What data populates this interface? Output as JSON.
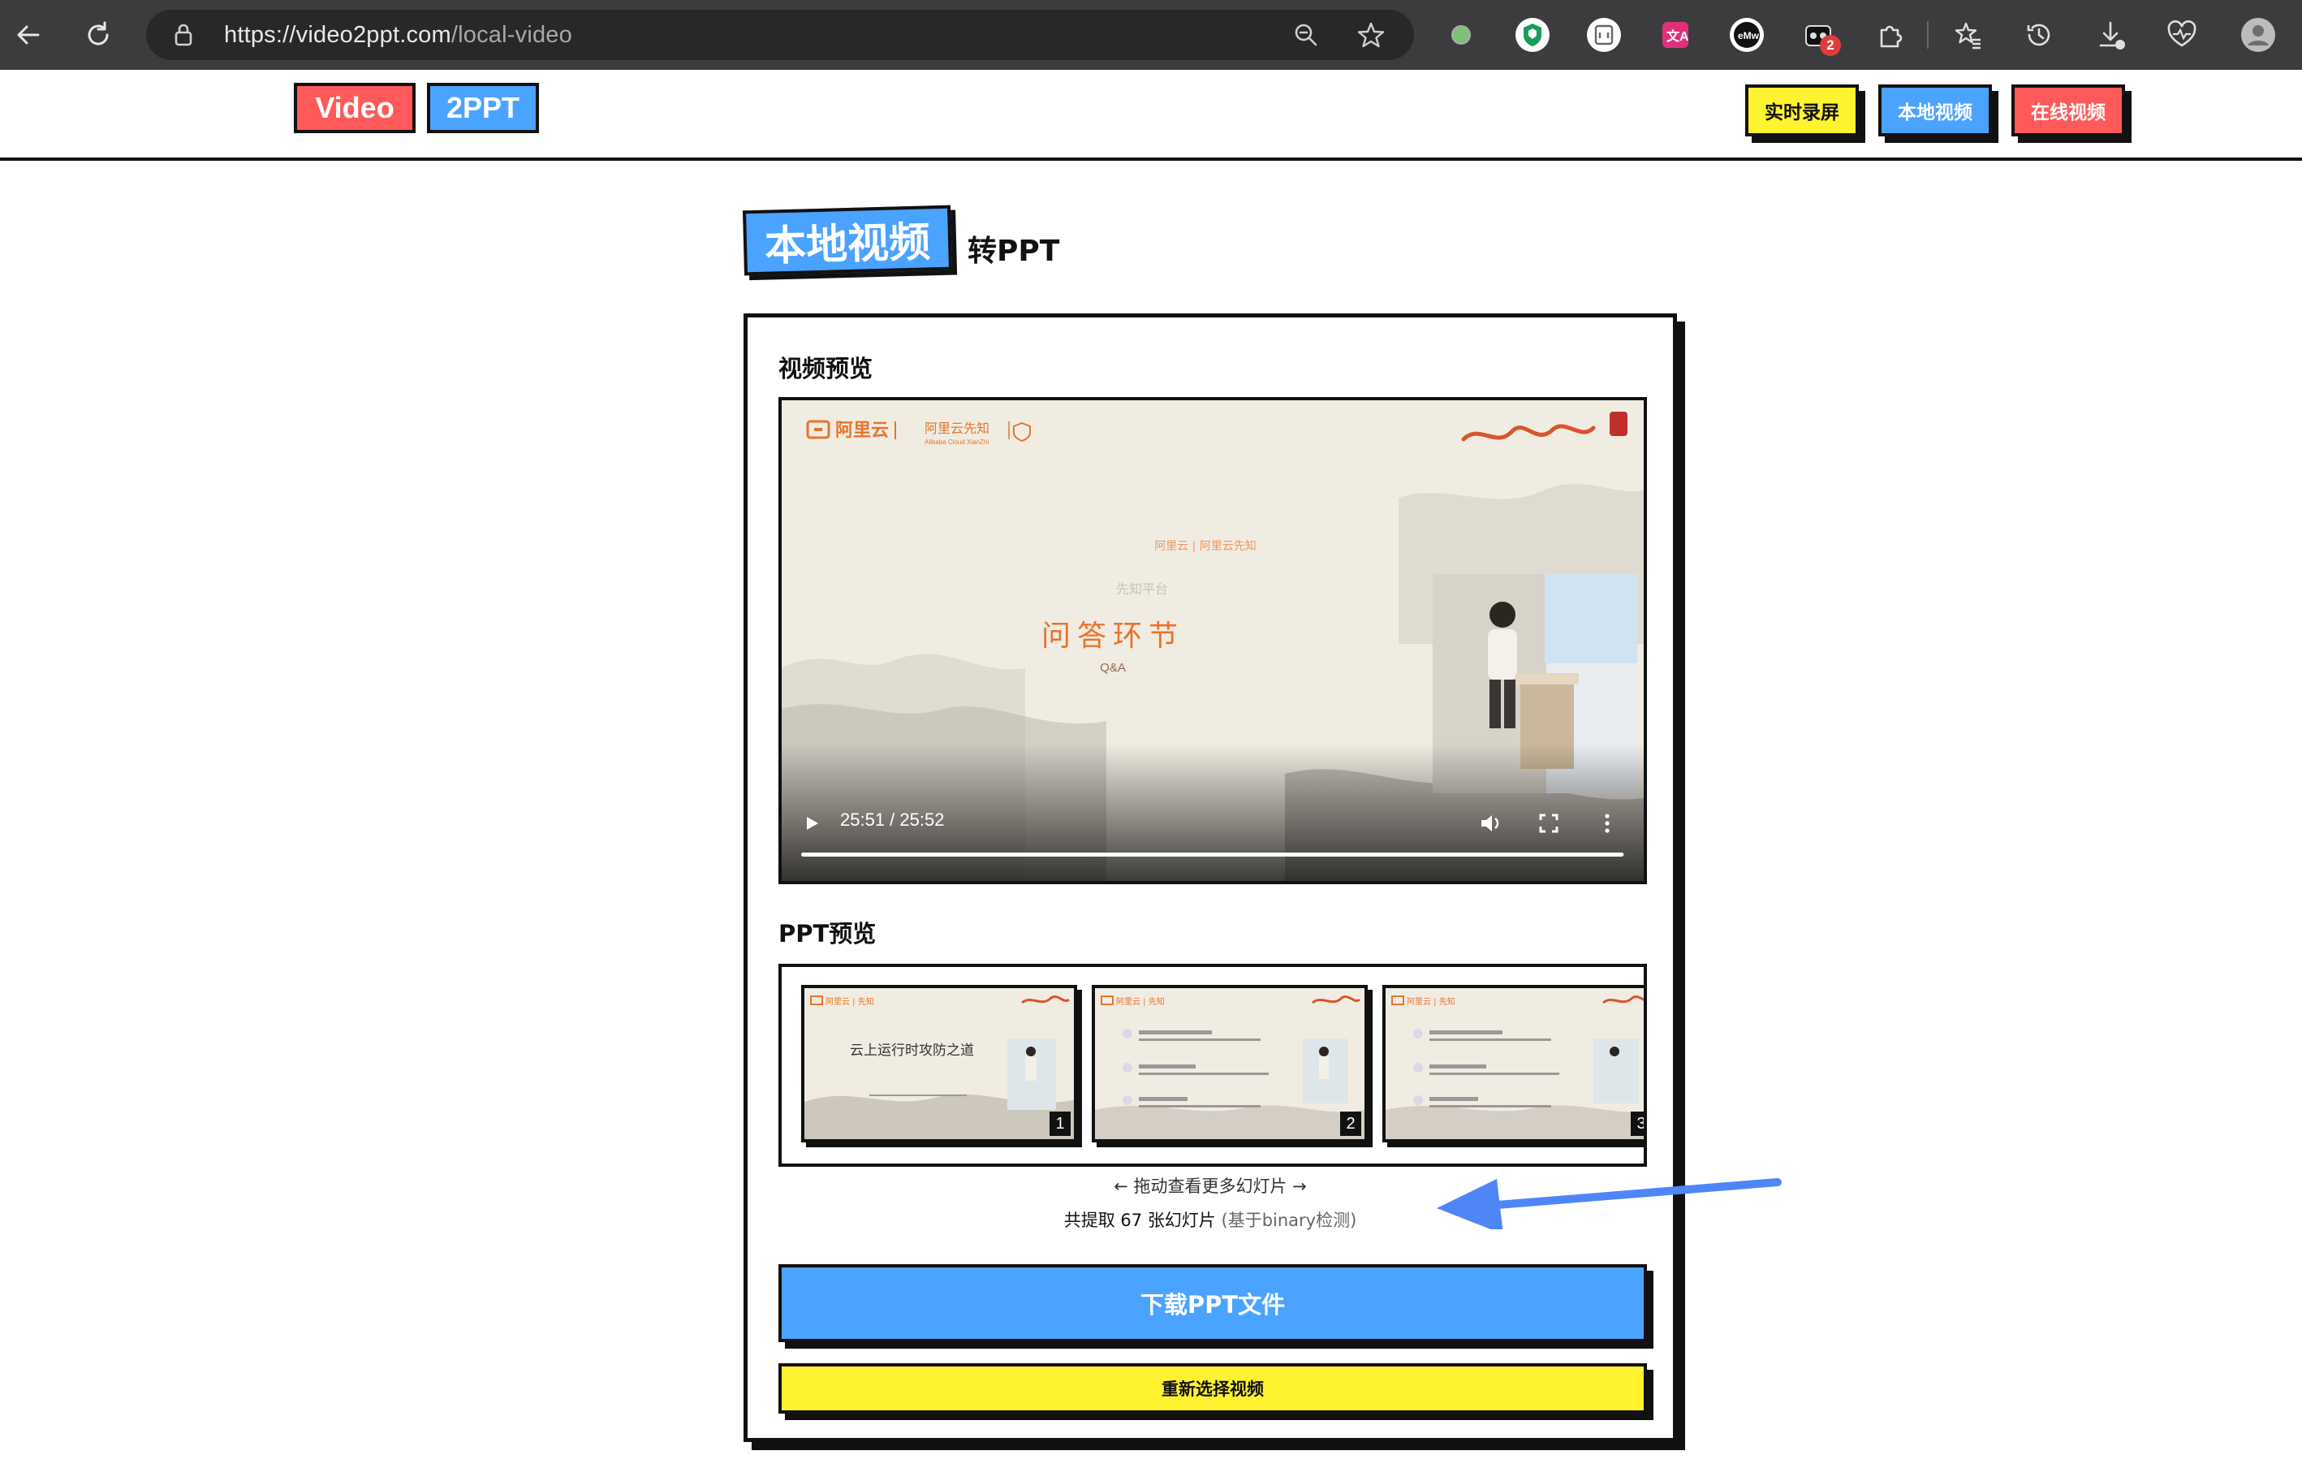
{
  "browser": {
    "url_host": "https://video2ppt.com",
    "url_path": "/local-video",
    "download_badge": "2"
  },
  "header": {
    "logo_left": "Video",
    "logo_right": "2PPT",
    "nav": [
      {
        "label": "实时录屏",
        "color": "#fff22e"
      },
      {
        "label": "本地视频",
        "color": "#4aa3ff"
      },
      {
        "label": "在线视频",
        "color": "#ff5a5a"
      }
    ]
  },
  "page": {
    "title_tag": "本地视频",
    "title_suffix": "转PPT"
  },
  "video": {
    "section_title": "视频预览",
    "slide_title": "问答环节",
    "slide_subtitle": "Q&A",
    "brand_left": "阿里云",
    "brand_mid": "阿里云先知",
    "current_time": "25:51",
    "duration": "25:52",
    "progress": 0.999
  },
  "ppt": {
    "section_title": "PPT预览",
    "thumbnails": [
      {
        "number": "1",
        "title": "云上运行时攻防之道"
      },
      {
        "number": "2",
        "title": ""
      },
      {
        "number": "3",
        "title": ""
      }
    ],
    "drag_hint": "← 拖动查看更多幻灯片 →",
    "count_prefix": "共提取",
    "count_value": "67",
    "count_suffix": "张幻灯片",
    "count_note": "(基于binary检测)"
  },
  "actions": {
    "download_label": "下载PPT文件",
    "reselect_label": "重新选择视频"
  },
  "colors": {
    "blue": "#4aa3ff",
    "yellow": "#fff22e",
    "red": "#ff5a5a",
    "annotation_arrow": "#4f86f7",
    "brand_orange": "#e8742c"
  }
}
